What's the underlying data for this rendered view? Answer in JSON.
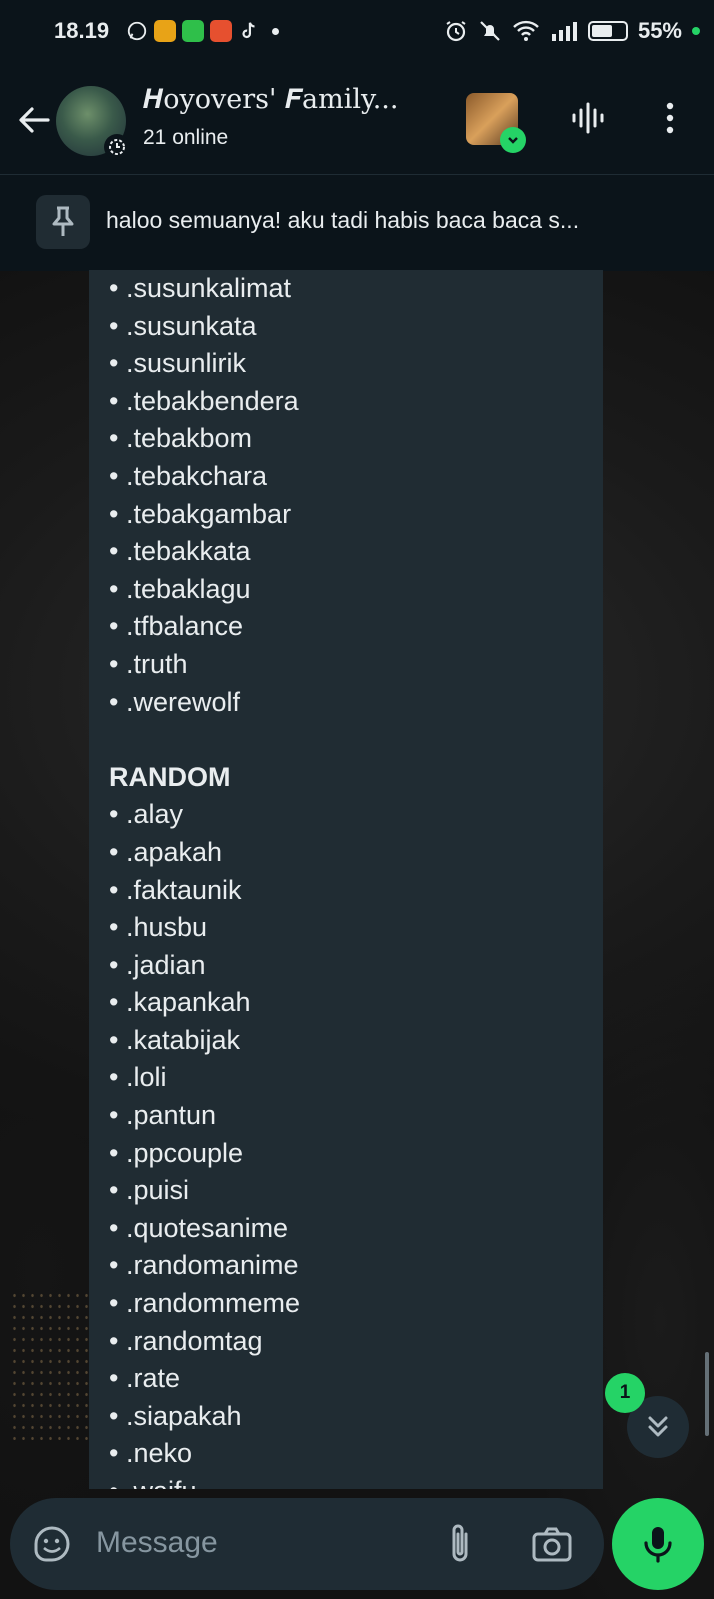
{
  "status_bar": {
    "time": "18.19",
    "battery": "55%",
    "icons": [
      "whatsapp-icon",
      "calendar-app-icon",
      "shopee-icon",
      "game-app-icon",
      "tiktok-icon",
      "dot-icon",
      "alarm-icon",
      "mute-icon",
      "wifi-icon",
      "signal-icon",
      "battery-icon"
    ]
  },
  "header": {
    "title": "𝑯oyovers' 𝑭amily...",
    "subtitle": "21 online"
  },
  "pinned": {
    "text": "haloo semuanya! aku tadi habis baca baca s..."
  },
  "message": {
    "lines_top": [
      ".susunkalimat",
      ".susunkata",
      ".susunlirik",
      ".tebakbendera",
      ".tebakbom",
      ".tebakchara",
      ".tebakgambar",
      ".tebakkata",
      ".tebaklagu",
      ".tfbalance",
      ".truth",
      ".werewolf"
    ],
    "section_heading": "RANDOM",
    "lines_random": [
      ".alay",
      ".apakah",
      ".faktaunik",
      ".husbu",
      ".jadian",
      ".kapankah",
      ".katabijak",
      ".loli",
      ".pantun",
      ".ppcouple",
      ".puisi",
      ".quotesanime",
      ".randomanime",
      ".randommeme",
      ".randomtag",
      ".rate",
      ".siapakah",
      ".neko",
      ".waifu"
    ],
    "bullet": "•"
  },
  "scroll": {
    "unread_count": "1"
  },
  "input": {
    "placeholder": "Message"
  },
  "colors": {
    "accent": "#25d366",
    "bubble": "#202c33",
    "header_bg": "#0b141a"
  }
}
